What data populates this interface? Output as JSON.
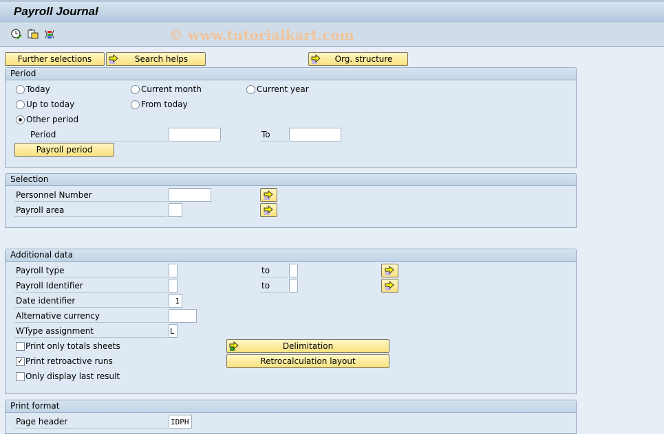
{
  "window": {
    "title": "Payroll Journal",
    "watermark": "© www.tutorialkart.com"
  },
  "toolbar": {
    "icons": [
      "execute-clock-icon",
      "get-variant-icon",
      "selection-options-icon"
    ]
  },
  "top_buttons": {
    "further_selections": "Further selections",
    "search_helps": "Search helps",
    "org_structure": "Org. structure"
  },
  "period": {
    "title": "Period",
    "radios": [
      {
        "label": "Today",
        "selected": false
      },
      {
        "label": "Current month",
        "selected": false
      },
      {
        "label": "Current year",
        "selected": false
      },
      {
        "label": "Up to today",
        "selected": false
      },
      {
        "label": "From today",
        "selected": false
      },
      {
        "label": "Other period",
        "selected": true
      }
    ],
    "period_label": "Period",
    "period_from": "",
    "to_label": "To",
    "period_to": "",
    "payroll_period_button": "Payroll period"
  },
  "selection": {
    "title": "Selection",
    "fields": [
      {
        "label": "Personnel Number",
        "value": ""
      },
      {
        "label": "Payroll area",
        "value": ""
      }
    ]
  },
  "additional": {
    "title": "Additional data",
    "fields": [
      {
        "label": "Payroll type",
        "value": "",
        "to_label": "to",
        "to_value": ""
      },
      {
        "label": "Payroll Identifier",
        "value": "",
        "to_label": "to",
        "to_value": ""
      },
      {
        "label": "Date identifier",
        "value": "1"
      },
      {
        "label": "Alternative currency",
        "value": ""
      },
      {
        "label": "WType assignment",
        "value": "L"
      }
    ],
    "checkboxes": [
      {
        "label": "Print only totals sheets",
        "checked": false
      },
      {
        "label": "Print retroactive runs",
        "checked": true
      },
      {
        "label": "Only display last result",
        "checked": false
      }
    ],
    "delimitation_button": "Delimitation",
    "retro_layout_button": "Retrocalculation layout"
  },
  "print_format": {
    "title": "Print format",
    "fields": [
      {
        "label": "Page header",
        "value": "IDPH"
      }
    ]
  }
}
